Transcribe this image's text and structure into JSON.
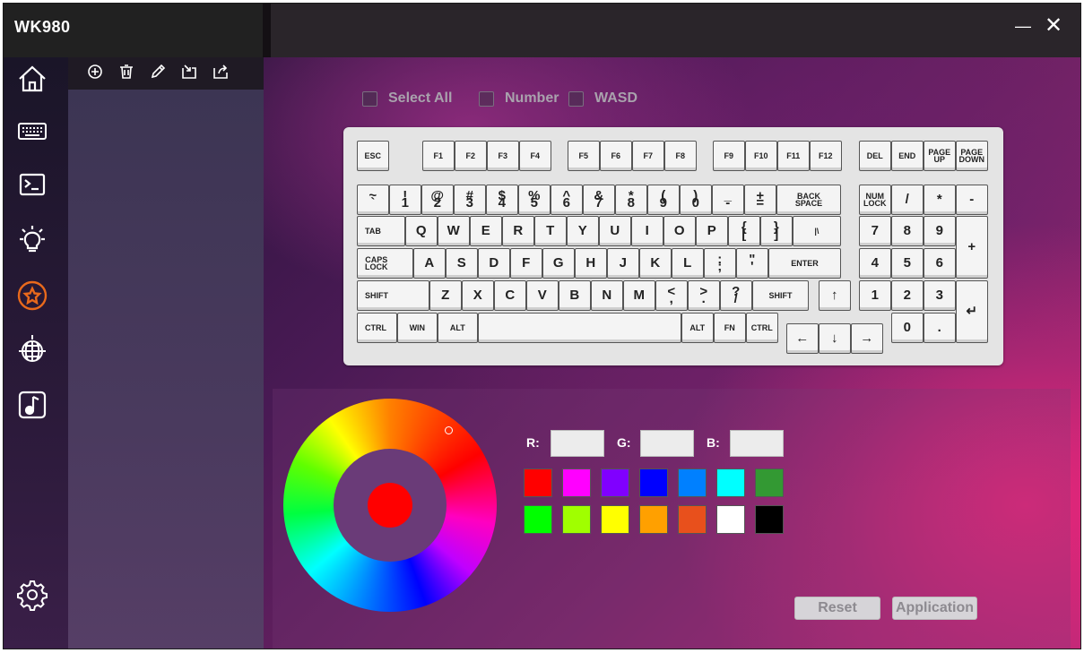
{
  "app": {
    "title": "WK980"
  },
  "window": {
    "minimize": "—",
    "close": "✕"
  },
  "sidebar": {
    "items": [
      {
        "name": "home-icon"
      },
      {
        "name": "keyboard-icon"
      },
      {
        "name": "macro-icon"
      },
      {
        "name": "lighting-icon"
      },
      {
        "name": "profile-star-icon",
        "active": true
      },
      {
        "name": "disco-ball-icon"
      },
      {
        "name": "music-icon"
      },
      {
        "name": "settings-icon"
      }
    ],
    "accent": "#e8691c"
  },
  "profile_toolbar": [
    "add-icon",
    "delete-icon",
    "edit-icon",
    "import-icon",
    "export-icon"
  ],
  "options": {
    "select_all": "Select All",
    "number": "Number",
    "wasd": "WASD"
  },
  "keyboard": {
    "row1": [
      "ESC",
      "F1",
      "F2",
      "F3",
      "F4",
      "F5",
      "F6",
      "F7",
      "F8",
      "F9",
      "F10",
      "F11",
      "F12",
      "DEL",
      "END",
      "PAGE\nUP",
      "PAGE\nDOWN"
    ],
    "row2": [
      "~\n`",
      "!\n1",
      "@\n2",
      "#\n3",
      "$\n4",
      "%\n5",
      "^\n6",
      "&\n7",
      "*\n8",
      "(\n9",
      ")\n0",
      "_\n-",
      "+\n=",
      "BACK\nSPACE",
      "NUM\nLOCK",
      "/",
      "*",
      "-"
    ],
    "row3": [
      "TAB",
      "Q",
      "W",
      "E",
      "R",
      "T",
      "Y",
      "U",
      "I",
      "O",
      "P",
      "{\n[",
      "}\n]",
      "|\\",
      "7",
      "8",
      "9",
      "+"
    ],
    "row4": [
      "CAPS\nLOCK",
      "A",
      "S",
      "D",
      "F",
      "G",
      "H",
      "J",
      "K",
      "L",
      ":\n;",
      "\"\n'",
      "ENTER",
      "4",
      "5",
      "6"
    ],
    "row5": [
      "SHIFT",
      "Z",
      "X",
      "C",
      "V",
      "B",
      "N",
      "M",
      "<\n,",
      ">\n.",
      "?\n/",
      "SHIFT",
      "↑",
      "1",
      "2",
      "3",
      "↵"
    ],
    "row6": [
      "CTRL",
      "WIN",
      "ALT",
      "",
      "ALT",
      "FN",
      "CTRL",
      "←",
      "↓",
      "→",
      "0",
      "."
    ]
  },
  "color": {
    "r_label": "R:",
    "g_label": "G:",
    "b_label": "B:",
    "r_value": "",
    "g_value": "",
    "b_value": "",
    "selected": "#ff0000",
    "swatches": [
      "#ff0000",
      "#ff00ff",
      "#8000ff",
      "#0000ff",
      "#0080ff",
      "#00ffff",
      "#339933",
      "#00ff00",
      "#a0ff00",
      "#ffff00",
      "#ffa000",
      "#e8501c",
      "#ffffff",
      "#000000"
    ]
  },
  "buttons": {
    "reset": "Reset",
    "apply": "Application"
  }
}
